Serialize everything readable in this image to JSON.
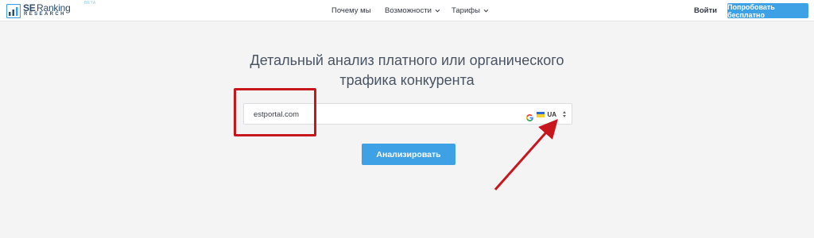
{
  "header": {
    "logo": {
      "brand_se": "SE",
      "brand_ranking": "Ranking",
      "beta": "BETA",
      "sub": "RESEARCH"
    },
    "nav": [
      {
        "label": "Почему мы",
        "has_dropdown": false
      },
      {
        "label": "Возможности",
        "has_dropdown": true
      },
      {
        "label": "Тарифы",
        "has_dropdown": true
      }
    ],
    "login_label": "Войти",
    "try_label": "Попробовать бесплатно"
  },
  "main": {
    "title_line1": "Детальный анализ платного или органического",
    "title_line2": "трафика конкурента",
    "search": {
      "value": "estportal.com",
      "engine_icon": "google-g-icon",
      "country_flag": "ukraine-flag-icon",
      "country_code": "UA"
    },
    "analyze_label": "Анализировать"
  },
  "colors": {
    "accent": "#3ea1e5",
    "annotation": "#c8161d",
    "background": "#f4f4f5"
  }
}
